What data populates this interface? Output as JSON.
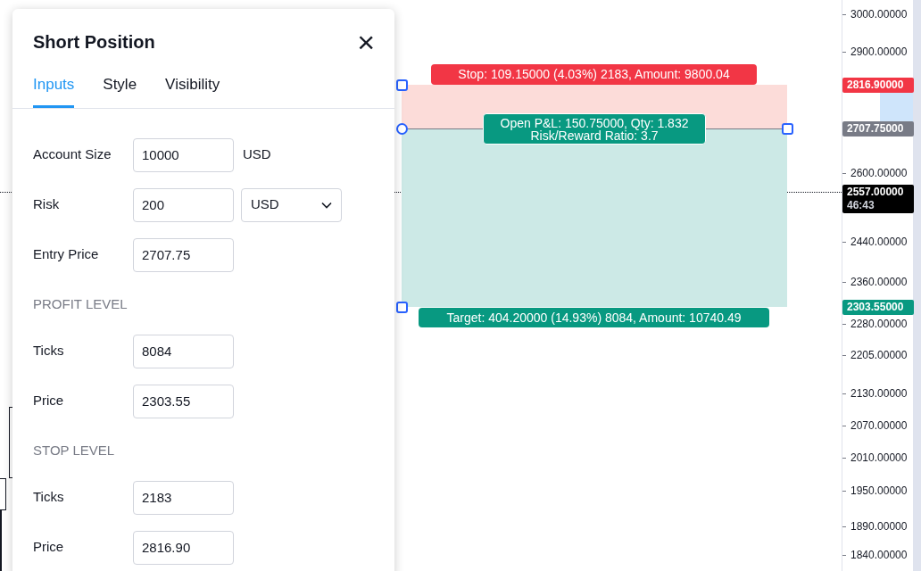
{
  "dialog": {
    "title": "Short Position",
    "close": "×",
    "tabs": [
      {
        "label": "Inputs",
        "selected": true
      },
      {
        "label": "Style",
        "selected": false
      },
      {
        "label": "Visibility",
        "selected": false
      }
    ],
    "rows": [
      {
        "kind": "field",
        "label": "Account Size",
        "value": "10000",
        "unit": "USD"
      },
      {
        "kind": "field",
        "label": "Risk",
        "value": "200",
        "select": "USD"
      },
      {
        "kind": "field",
        "label": "Entry Price",
        "value": "2707.75"
      },
      {
        "kind": "header",
        "label": "PROFIT LEVEL"
      },
      {
        "kind": "field",
        "label": "Ticks",
        "value": "8084"
      },
      {
        "kind": "field",
        "label": "Price",
        "value": "2303.55"
      },
      {
        "kind": "header",
        "label": "STOP LEVEL"
      },
      {
        "kind": "field",
        "label": "Ticks",
        "value": "2183"
      },
      {
        "kind": "field",
        "label": "Price",
        "value": "2816.90"
      }
    ]
  },
  "position": {
    "stop_label": "Stop: 109.15000 (4.03%) 2183, Amount: 9800.04",
    "pnl_label": [
      "Open P&L: 150.75000, Qty: 1.832",
      "Risk/Reward Ratio: 3.7"
    ],
    "target_label": "Target: 404.20000 (14.93%) 8084, Amount: 10740.49"
  },
  "price_axis": [
    {
      "kind": "tick",
      "text": "3000.00000"
    },
    {
      "kind": "tick",
      "text": "2900.00000"
    },
    {
      "kind": "marker",
      "text": "2816.90000",
      "color": "#f23645"
    },
    {
      "kind": "marker",
      "text": "2707.75000",
      "color": "#787b86"
    },
    {
      "kind": "tick",
      "text": "2600.00000"
    },
    {
      "kind": "marker",
      "text": "2557.00000",
      "sub": "46:43",
      "color": "#000000"
    },
    {
      "kind": "tick",
      "text": "2440.00000"
    },
    {
      "kind": "tick",
      "text": "2360.00000"
    },
    {
      "kind": "marker",
      "text": "2303.55000",
      "color": "#089981"
    },
    {
      "kind": "tick",
      "text": "2280.00000"
    },
    {
      "kind": "tick",
      "text": "2205.00000"
    },
    {
      "kind": "tick",
      "text": "2130.00000"
    },
    {
      "kind": "tick",
      "text": "2070.00000"
    },
    {
      "kind": "tick",
      "text": "2010.00000"
    },
    {
      "kind": "tick",
      "text": "1950.00000"
    },
    {
      "kind": "tick",
      "text": "1890.00000"
    },
    {
      "kind": "tick",
      "text": "1840.00000"
    }
  ]
}
